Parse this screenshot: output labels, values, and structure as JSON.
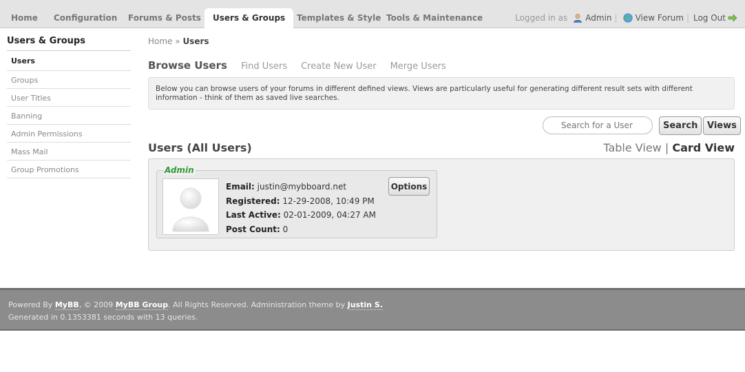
{
  "nav": {
    "tabs": [
      {
        "label": "Home"
      },
      {
        "label": "Configuration"
      },
      {
        "label": "Forums & Posts"
      },
      {
        "label": "Users & Groups"
      },
      {
        "label": "Templates & Style"
      },
      {
        "label": "Tools & Maintenance"
      }
    ],
    "active_tab": "Users & Groups"
  },
  "userbar": {
    "logged_in_as": "Logged in as",
    "username": "Admin",
    "view_forum": "View Forum",
    "logout": "Log Out",
    "user_icon": "user-icon",
    "globe_icon": "globe-icon",
    "arrow_icon": "arrow-right-icon"
  },
  "sidebar": {
    "title": "Users & Groups",
    "items": [
      {
        "label": "Users"
      },
      {
        "label": "Groups"
      },
      {
        "label": "User Titles"
      },
      {
        "label": "Banning"
      },
      {
        "label": "Admin Permissions"
      },
      {
        "label": "Mass Mail"
      },
      {
        "label": "Group Promotions"
      }
    ]
  },
  "breadcrumb": {
    "home": "Home",
    "sep": "»",
    "current": "Users"
  },
  "subtabs": {
    "browse": "Browse Users",
    "find": "Find Users",
    "create": "Create New User",
    "merge": "Merge Users"
  },
  "info": {
    "text": "Below you can browse users of your forums in different defined views. Views are particularly useful for generating different result sets with different information - think of them as saved live searches."
  },
  "search": {
    "placeholder": "Search for a User",
    "search_label": "Search",
    "views_label": "Views"
  },
  "section": {
    "title": "Users (All Users)",
    "table_view": "Table View",
    "divider": "|",
    "card_view": "Card View"
  },
  "user_card": {
    "name": "Admin",
    "name_color": "#339933",
    "email_label": "Email:",
    "email": "justin@mybboard.net",
    "registered_label": "Registered:",
    "registered": "12-29-2008, 10:49 PM",
    "last_active_label": "Last Active:",
    "last_active": "02-01-2009, 04:27 AM",
    "post_count_label": "Post Count:",
    "post_count": "0",
    "options_label": "Options",
    "avatar_icon": "default-avatar-icon"
  },
  "footer": {
    "powered_by": "Powered By",
    "mybb": "MyBB",
    "copyright": ", © 2009",
    "group": "MyBB Group",
    "rights": ". All Rights Reserved. Administration theme by",
    "author": "Justin S.",
    "generated": "Generated in 0.1353381 seconds with 13 queries."
  }
}
